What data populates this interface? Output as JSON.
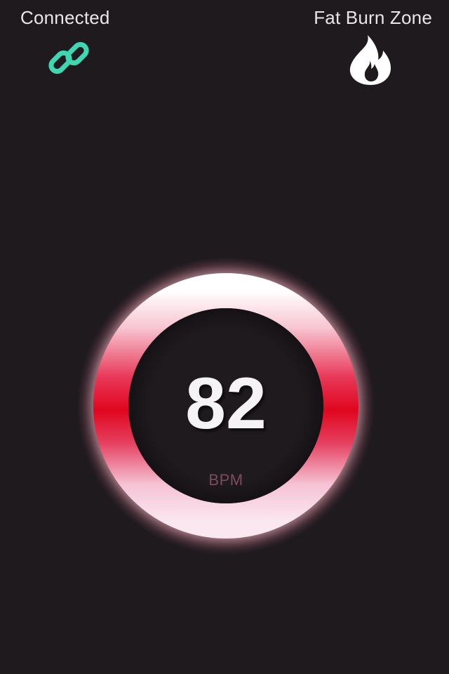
{
  "status": {
    "connection_label": "Connected",
    "connection_icon": "link-icon",
    "connection_color": "#3fd6b2",
    "zone_label": "Fat Burn Zone",
    "zone_icon": "flame-icon"
  },
  "heart_rate": {
    "value": "82",
    "unit": "BPM"
  },
  "colors": {
    "background": "#1f1a1e",
    "ring_primary": "#e3122e",
    "ring_highlight": "#ffffff",
    "unit_text": "#7a4c5e"
  }
}
